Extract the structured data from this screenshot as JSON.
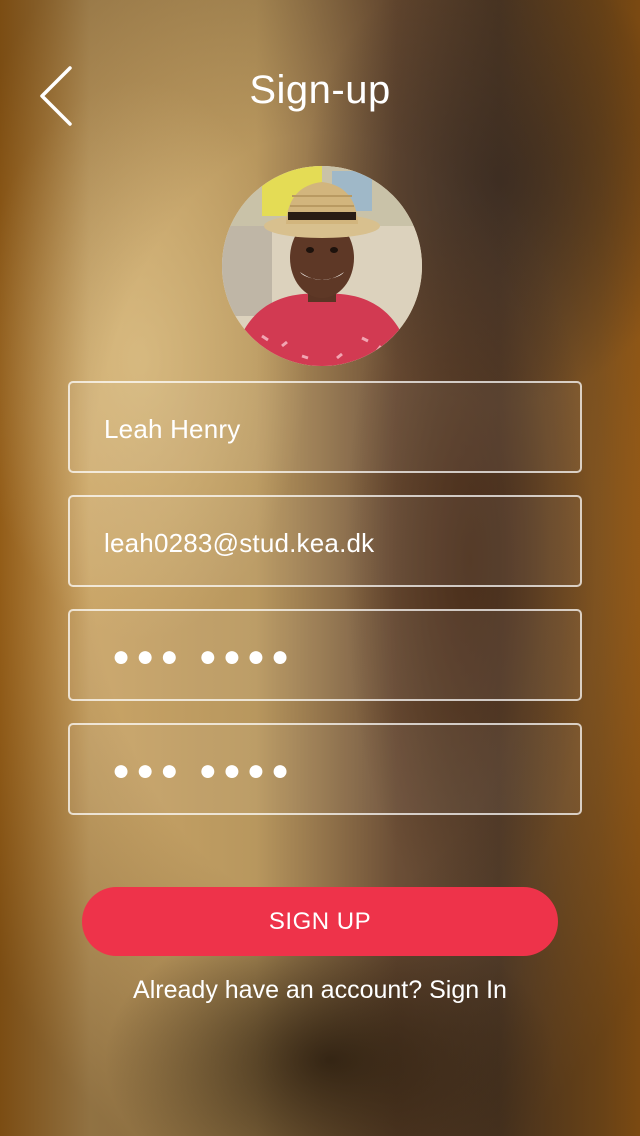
{
  "header": {
    "title": "Sign-up",
    "back_icon": "chevron-left-icon"
  },
  "profile": {
    "avatar": "user-photo-avatar"
  },
  "form": {
    "name_value": "Leah Henry",
    "email_value": "leah0283@stud.kea.dk",
    "password_masked": "●●● ●●●●",
    "confirm_password_masked": "●●● ●●●●"
  },
  "actions": {
    "signup_label": "SIGN UP",
    "account_prompt": "Already have an account?",
    "signin_label": "Sign In"
  },
  "colors": {
    "accent": "#ee334a",
    "text": "#ffffff"
  }
}
